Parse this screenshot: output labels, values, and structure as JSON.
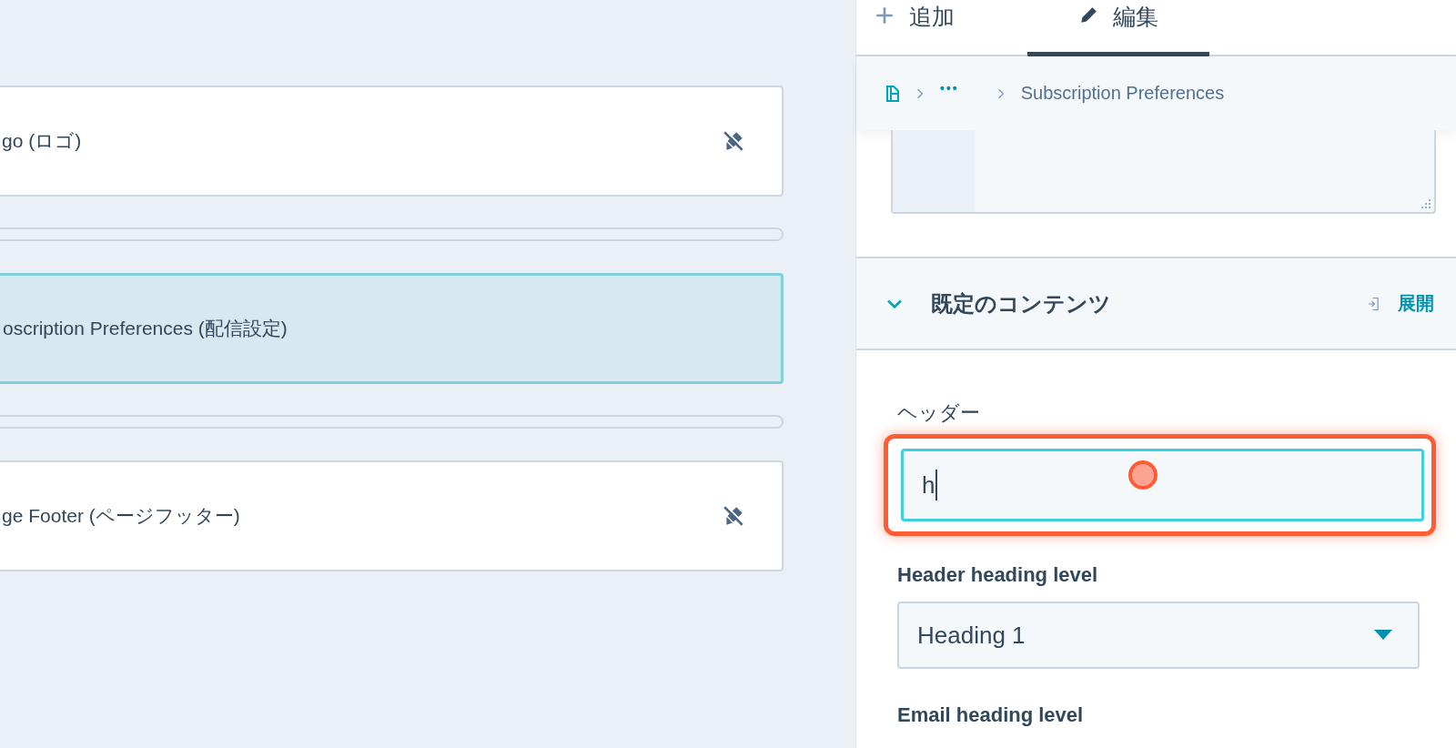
{
  "canvas": {
    "modules": [
      {
        "label": "go (ロゴ)",
        "selected": false,
        "editable": false
      },
      {
        "label": "oscription Preferences (配信設定)",
        "selected": true,
        "editable": true
      },
      {
        "label": "ge Footer (ページフッター)",
        "selected": false,
        "editable": false
      }
    ]
  },
  "sidebar": {
    "tabs": [
      {
        "label": "追加",
        "kind": "add",
        "selected": false
      },
      {
        "label": "編集",
        "kind": "edit",
        "selected": true
      }
    ],
    "breadcrumb": {
      "more": "•••",
      "current": "Subscription Preferences"
    },
    "section": {
      "title": "既定のコンテンツ",
      "expanded": true,
      "action": "展開"
    },
    "fields": [
      {
        "label": "ヘッダー",
        "kind": "text",
        "value": "h",
        "highlighted": true
      },
      {
        "label": "Header heading level",
        "kind": "select",
        "value": "Heading 1"
      },
      {
        "label": "Email heading level",
        "kind": "label"
      }
    ]
  }
}
